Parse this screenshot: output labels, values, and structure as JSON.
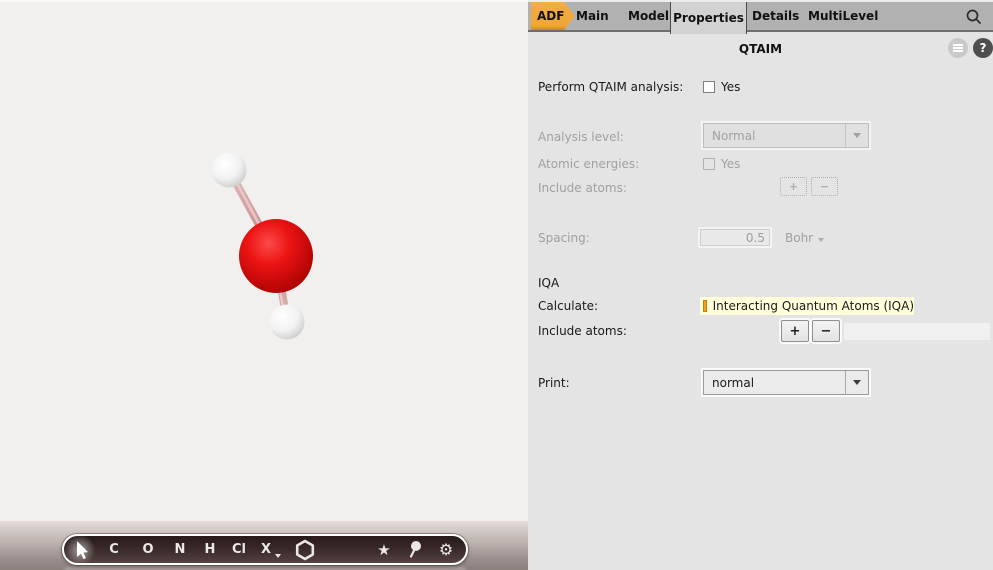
{
  "tabs": {
    "items": [
      {
        "label": "ADF",
        "active": false
      },
      {
        "label": "Main",
        "active": false
      },
      {
        "label": "Model",
        "active": false
      },
      {
        "label": "Properties",
        "active": true
      },
      {
        "label": "Details",
        "active": false
      },
      {
        "label": "MultiLevel",
        "active": false
      }
    ]
  },
  "header": {
    "title": "QTAIM",
    "help_glyph": "?"
  },
  "form": {
    "perform": {
      "label": "Perform QTAIM analysis:",
      "option": "Yes",
      "checked": false,
      "enabled": true
    },
    "analysis_level": {
      "label": "Analysis level:",
      "value": "Normal",
      "enabled": false
    },
    "atomic_energies": {
      "label": "Atomic energies:",
      "option": "Yes",
      "checked": false,
      "enabled": false
    },
    "include_atoms_qtaim": {
      "label": "Include atoms:",
      "plus": "+",
      "minus": "−",
      "enabled": false
    },
    "spacing": {
      "label": "Spacing:",
      "value": "0.5",
      "unit": "Bohr",
      "enabled": false
    },
    "iqa_section": {
      "label": "IQA"
    },
    "calculate": {
      "label": "Calculate:",
      "option": "Interacting Quantum Atoms (IQA)",
      "checked": true,
      "enabled": true
    },
    "include_atoms_iqa": {
      "label": "Include atoms:",
      "plus": "+",
      "minus": "−",
      "value": "",
      "enabled": true
    },
    "print": {
      "label": "Print:",
      "value": "normal",
      "enabled": true
    }
  },
  "toolbar": {
    "elements": [
      "C",
      "O",
      "N",
      "H",
      "Cl",
      "X"
    ],
    "star_glyph": "★",
    "gear_glyph": "⚙",
    "icons": [
      "cursor-icon",
      "element-dropdown-caret",
      "ring-tool-icon",
      "star-icon",
      "balloon-icon",
      "gear-icon"
    ]
  },
  "molecule": {
    "formula_depicted": "H2O",
    "atoms": [
      {
        "element": "O",
        "color": "#e01010"
      },
      {
        "element": "H",
        "color": "#ffffff"
      },
      {
        "element": "H",
        "color": "#ffffff"
      }
    ],
    "bonds": [
      [
        "O",
        "H1"
      ],
      [
        "O",
        "H2"
      ]
    ]
  },
  "colors": {
    "adf_tab_orange": "#f0a636",
    "tab_bar": "#b1b1b1",
    "active_tab": "#d2d2d2",
    "panel_bg": "#e4e4e4",
    "viewer_bg": "#f1f0ef",
    "highlight_row": "#ffffdc",
    "checked_checkbox_orange": "#f6a01e",
    "toolbar_pill": "#3a2a2a"
  }
}
